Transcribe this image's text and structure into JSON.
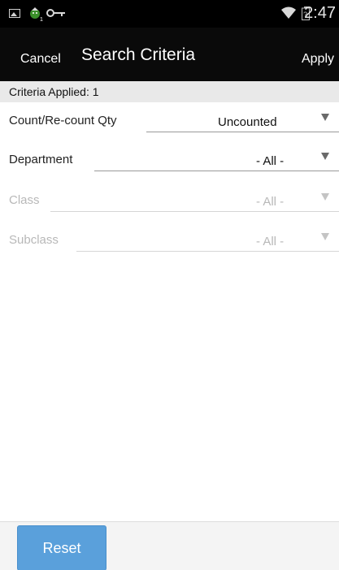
{
  "status_bar": {
    "time": "2:47",
    "icons": [
      "picture-icon",
      "android-notification-icon",
      "key-icon",
      "wifi-icon",
      "battery-icon"
    ]
  },
  "action_bar": {
    "cancel_label": "Cancel",
    "title": "Search Criteria",
    "apply_label": "Apply"
  },
  "criteria": {
    "applied_text": "Criteria Applied: 1"
  },
  "fields": [
    {
      "label": "Count/Re-count Qty",
      "value": "Uncounted",
      "enabled": true
    },
    {
      "label": "Department",
      "value": "- All -",
      "enabled": true
    },
    {
      "label": "Class",
      "value": "- All -",
      "enabled": false
    },
    {
      "label": "Subclass",
      "value": "- All -",
      "enabled": false
    }
  ],
  "bottom_bar": {
    "reset_label": "Reset"
  },
  "colors": {
    "reset_button": "#5aa0db",
    "action_bar": "#0a0a0a",
    "criteria_bar": "#e9e9e9"
  }
}
